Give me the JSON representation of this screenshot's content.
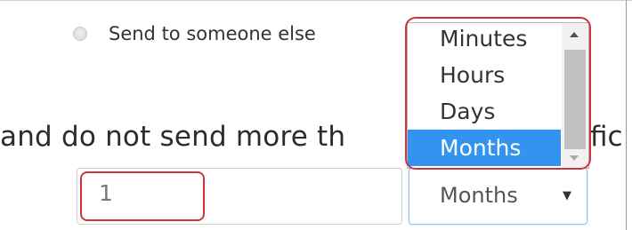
{
  "radio": {
    "label": "Send to someone else",
    "checked": false
  },
  "sentence": {
    "visible_start": "and do not send more th",
    "visible_end": "fic"
  },
  "number_input": {
    "value": "1"
  },
  "unit_select": {
    "selected": "Months",
    "options": [
      "Minutes",
      "Hours",
      "Days",
      "Months"
    ],
    "highlighted_option": "Months"
  },
  "colors": {
    "highlight_option": "#3293f0",
    "annotation": "#d0343b",
    "select_focus_border": "#9ec0e4"
  },
  "icons": {
    "radio": "radio-circle",
    "select_caret": "caret-down",
    "scroll_up": "triangle-up",
    "scroll_down": "triangle-down"
  }
}
